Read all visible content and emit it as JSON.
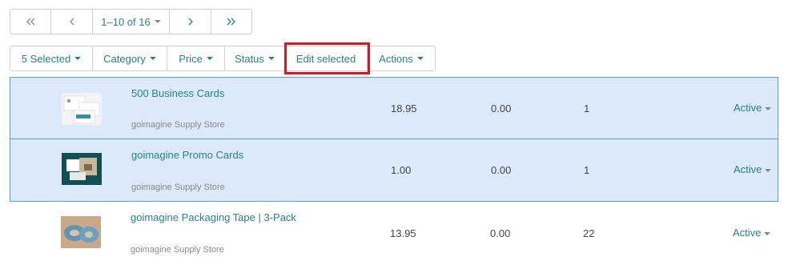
{
  "pagination": {
    "first_icon": "double-chevron-left-icon",
    "prev_icon": "chevron-left-icon",
    "range_label": "1–10 of 16",
    "next_icon": "chevron-right-icon",
    "last_icon": "double-chevron-right-icon"
  },
  "toolbar": {
    "selected_label": "5 Selected",
    "category_label": "Category",
    "price_label": "Price",
    "status_label": "Status",
    "edit_selected_label": "Edit selected",
    "actions_label": "Actions"
  },
  "rows": [
    {
      "name": "500 Business Cards",
      "store": "goimagine Supply Store",
      "price": "18.95",
      "cost": "0.00",
      "quantity": "1",
      "status": "Active",
      "selected": true
    },
    {
      "name": "goimagine Promo Cards",
      "store": "goimagine Supply Store",
      "price": "1.00",
      "cost": "0.00",
      "quantity": "1",
      "status": "Active",
      "selected": true
    },
    {
      "name": "goimagine Packaging Tape | 3-Pack",
      "store": "goimagine Supply Store",
      "price": "13.95",
      "cost": "0.00",
      "quantity": "22",
      "status": "Active",
      "selected": false
    }
  ],
  "colors": {
    "accent": "#2a8089",
    "selected_bg": "#dbe9fa",
    "selected_border": "#5b9bd5",
    "highlight": "#e0141e"
  }
}
